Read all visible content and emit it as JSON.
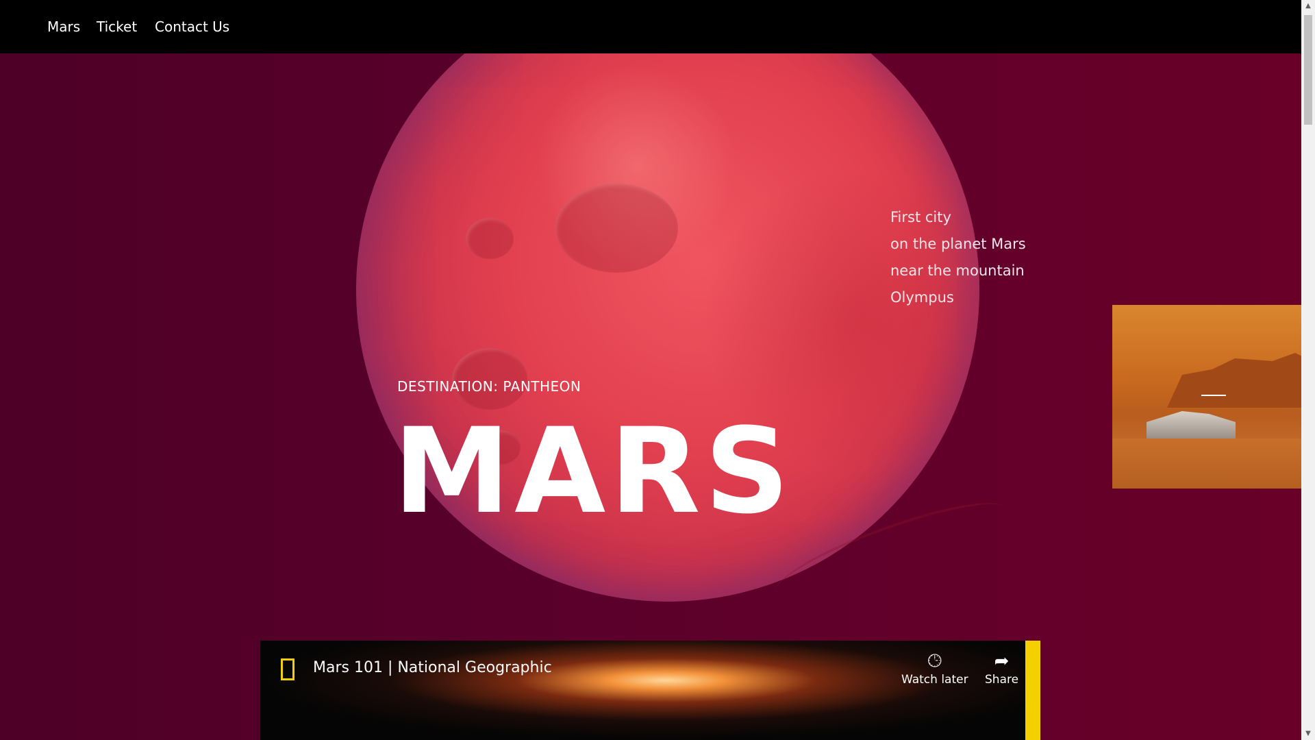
{
  "nav": {
    "items": [
      {
        "label": "Mars"
      },
      {
        "label": "Ticket"
      },
      {
        "label": "Contact Us"
      }
    ]
  },
  "hero": {
    "tagline": [
      "First city",
      "on the planet Mars",
      "near the mountain",
      "Olympus"
    ],
    "destination": "DESTINATION: PANTHEON",
    "title": "MARS"
  },
  "video": {
    "title": "Mars 101 | National Geographic",
    "watch_later": "Watch later",
    "share": "Share",
    "icons": {
      "watch_later": "clock-icon",
      "share": "share-arrow-icon",
      "logo": "natgeo-logo-icon"
    }
  },
  "colors": {
    "nav_bg": "#000000",
    "hero_bg": "#5a0028",
    "planet": "#e2404f",
    "text": "#ffffff",
    "accent_yellow": "#f5d000"
  }
}
